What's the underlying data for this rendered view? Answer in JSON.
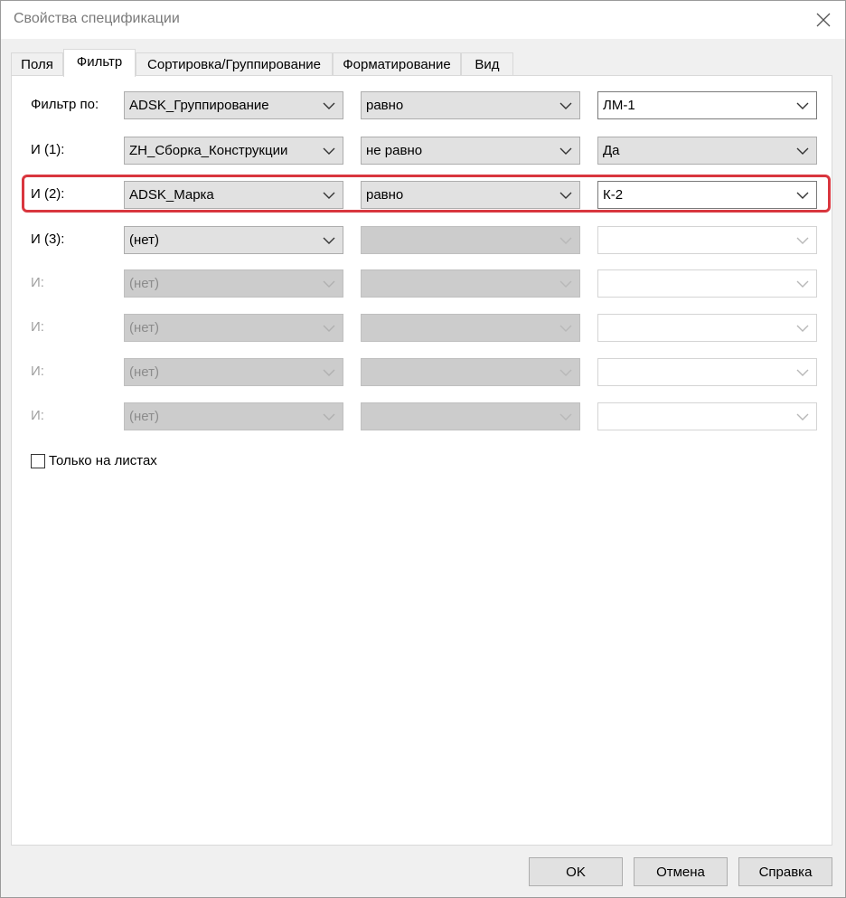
{
  "window": {
    "title": "Свойства спецификации"
  },
  "tabs": [
    {
      "label": "Поля"
    },
    {
      "label": "Фильтр"
    },
    {
      "label": "Сортировка/Группирование"
    },
    {
      "label": "Форматирование"
    },
    {
      "label": "Вид"
    }
  ],
  "active_tab": "Фильтр",
  "filters": [
    {
      "label": "Фильтр по:",
      "field": "ADSK_Группирование",
      "condition": "равно",
      "value": "ЛМ-1",
      "enabled": true
    },
    {
      "label": "И (1):",
      "field": "ZH_Сборка_Конструкции",
      "condition": "не равно",
      "value": "Да",
      "enabled": true
    },
    {
      "label": "И (2):",
      "field": "ADSK_Марка",
      "condition": "равно",
      "value": "К-2",
      "enabled": true,
      "highlighted": true
    },
    {
      "label": "И (3):",
      "field": "(нет)",
      "condition": "",
      "value": "",
      "enabled": true
    },
    {
      "label": "И:",
      "field": "(нет)",
      "condition": "",
      "value": "",
      "enabled": false
    },
    {
      "label": "И:",
      "field": "(нет)",
      "condition": "",
      "value": "",
      "enabled": false
    },
    {
      "label": "И:",
      "field": "(нет)",
      "condition": "",
      "value": "",
      "enabled": false
    },
    {
      "label": "И:",
      "field": "(нет)",
      "condition": "",
      "value": "",
      "enabled": false
    }
  ],
  "sheets_only": {
    "label": "Только на листах",
    "checked": false
  },
  "buttons": {
    "ok": "OK",
    "cancel": "Отмена",
    "help": "Справка"
  },
  "colors": {
    "highlight": "#d9363e",
    "dropdown_bg": "#e1e1e1",
    "disabled_bg": "#cccccc"
  }
}
